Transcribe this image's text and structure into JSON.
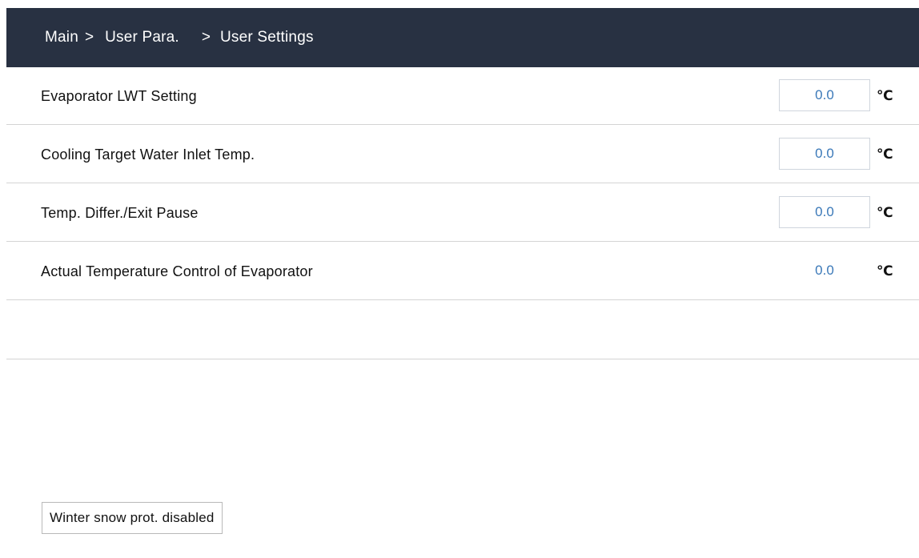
{
  "breadcrumb": {
    "items": [
      "Main",
      "User Para.",
      "User Settings"
    ],
    "separator": ">"
  },
  "settings": [
    {
      "label": "Evaporator LWT Setting",
      "value": "0.0",
      "unit": "℃",
      "editable": true
    },
    {
      "label": "Cooling Target Water Inlet Temp.",
      "value": "0.0",
      "unit": "℃",
      "editable": true
    },
    {
      "label": "Temp. Differ./Exit Pause",
      "value": "0.0",
      "unit": "℃",
      "editable": true
    },
    {
      "label": "Actual Temperature Control of Evaporator",
      "value": "0.0",
      "unit": "℃",
      "editable": false
    }
  ],
  "status": {
    "text": "Winter snow prot. disabled"
  },
  "colors": {
    "header_bg": "#283142",
    "value_text": "#3a78b8",
    "divider": "#d4d4d4"
  }
}
